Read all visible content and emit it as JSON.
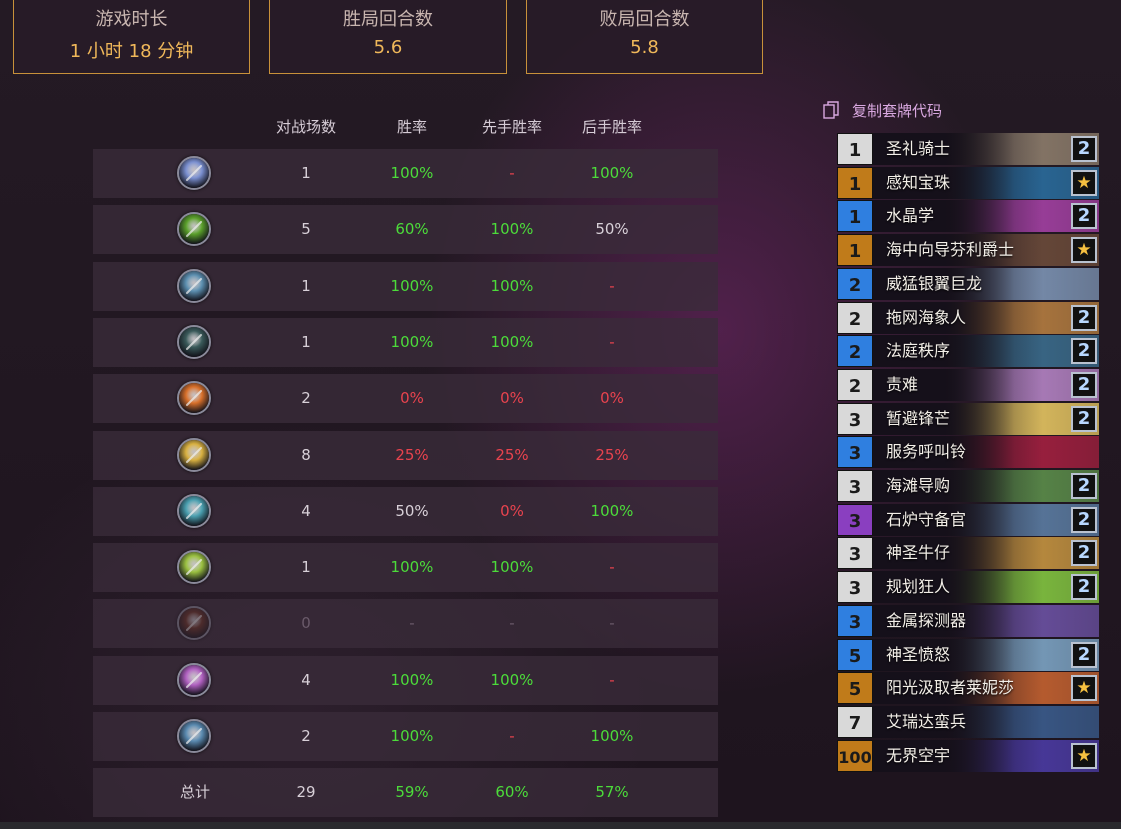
{
  "summary": [
    {
      "label": "游戏时长",
      "value": "1 小时 18 分钟"
    },
    {
      "label": "胜局回合数",
      "value": "5.6"
    },
    {
      "label": "败局回合数",
      "value": "5.8"
    }
  ],
  "table": {
    "headers": [
      "对战场数",
      "胜率",
      "先手胜率",
      "后手胜率"
    ],
    "rows": [
      {
        "icon": "priest-class-icon",
        "color": "#7a8fd0",
        "games": "1",
        "winrate": "100%",
        "first": "-",
        "second": "100%"
      },
      {
        "icon": "hunter-class-icon",
        "color": "#5aa02a",
        "games": "5",
        "winrate": "60%",
        "first": "100%",
        "second": "50%"
      },
      {
        "icon": "warrior-class-icon",
        "color": "#5c8fb0",
        "games": "1",
        "winrate": "100%",
        "first": "100%",
        "second": "-"
      },
      {
        "icon": "rogue-class-icon",
        "color": "#3a5a5a",
        "games": "1",
        "winrate": "100%",
        "first": "100%",
        "second": "-"
      },
      {
        "icon": "mage-class-icon",
        "color": "#d8702a",
        "games": "2",
        "winrate": "0%",
        "first": "0%",
        "second": "0%"
      },
      {
        "icon": "paladin-class-icon",
        "color": "#d8b040",
        "games": "8",
        "winrate": "25%",
        "first": "25%",
        "second": "25%"
      },
      {
        "icon": "shaman-class-icon",
        "color": "#4aa0b0",
        "games": "4",
        "winrate": "50%",
        "first": "0%",
        "second": "100%"
      },
      {
        "icon": "druid-class-icon",
        "color": "#9ac040",
        "games": "1",
        "winrate": "100%",
        "first": "100%",
        "second": "-"
      },
      {
        "icon": "warlock-class-icon",
        "color": "#6a3020",
        "games": "0",
        "winrate": "-",
        "first": "-",
        "second": "-"
      },
      {
        "icon": "demon-hunter-class-icon",
        "color": "#b060c0",
        "games": "4",
        "winrate": "100%",
        "first": "100%",
        "second": "-"
      },
      {
        "icon": "death-knight-class-icon",
        "color": "#5a8ab0",
        "games": "2",
        "winrate": "100%",
        "first": "-",
        "second": "100%"
      }
    ],
    "total": {
      "label": "总计",
      "games": "29",
      "winrate": "59%",
      "first": "60%",
      "second": "57%"
    }
  },
  "deck": {
    "copy_label": "复制套牌代码",
    "cards": [
      {
        "cost": "1",
        "name": "圣礼骑士",
        "count": "2",
        "rarity": "common",
        "art": "#8a7a6a"
      },
      {
        "cost": "1",
        "name": "感知宝珠",
        "count": "★",
        "rarity": "legendary",
        "art": "#2a6a9a"
      },
      {
        "cost": "1",
        "name": "水晶学",
        "count": "2",
        "rarity": "rare",
        "art": "#a040a0"
      },
      {
        "cost": "1",
        "name": "海中向导芬利爵士",
        "count": "★",
        "rarity": "legendary",
        "art": "#6a4a3a"
      },
      {
        "cost": "2",
        "name": "威猛银翼巨龙",
        "count": "",
        "rarity": "rare",
        "art": "#7a90b0"
      },
      {
        "cost": "2",
        "name": "拖网海象人",
        "count": "2",
        "rarity": "common",
        "art": "#b07a40"
      },
      {
        "cost": "2",
        "name": "法庭秩序",
        "count": "2",
        "rarity": "rare",
        "art": "#3a6a8a"
      },
      {
        "cost": "2",
        "name": "责难",
        "count": "2",
        "rarity": "common",
        "art": "#b080c0"
      },
      {
        "cost": "3",
        "name": "暂避锋芒",
        "count": "2",
        "rarity": "common",
        "art": "#e0c060"
      },
      {
        "cost": "3",
        "name": "服务呼叫铃",
        "count": "",
        "rarity": "rare",
        "art": "#a02040"
      },
      {
        "cost": "3",
        "name": "海滩导购",
        "count": "2",
        "rarity": "common",
        "art": "#5a8a4a"
      },
      {
        "cost": "3",
        "name": "石炉守备官",
        "count": "2",
        "rarity": "epic",
        "art": "#5a7aa0"
      },
      {
        "cost": "3",
        "name": "神圣牛仔",
        "count": "2",
        "rarity": "common",
        "art": "#c09040"
      },
      {
        "cost": "3",
        "name": "规划狂人",
        "count": "2",
        "rarity": "common",
        "art": "#80c040"
      },
      {
        "cost": "3",
        "name": "金属探测器",
        "count": "",
        "rarity": "rare",
        "art": "#6a50a0"
      },
      {
        "cost": "5",
        "name": "神圣愤怒",
        "count": "2",
        "rarity": "rare",
        "art": "#7aa0c0"
      },
      {
        "cost": "5",
        "name": "阳光汲取者莱妮莎",
        "count": "★",
        "rarity": "legendary",
        "art": "#c06030"
      },
      {
        "cost": "7",
        "name": "艾瑞达蛮兵",
        "count": "",
        "rarity": "common",
        "art": "#3a5a8a"
      },
      {
        "cost": "100",
        "name": "无界空宇",
        "count": "★",
        "rarity": "legendary",
        "art": "#4a3aa0"
      }
    ]
  },
  "colors": {
    "win": "#4cdc3a",
    "loss": "#e8434e",
    "neutral": "#d8d0d8",
    "muted": "#6a5a6a",
    "accent": "#f0b85a",
    "rarity": {
      "common": "#d9d9d9",
      "rare": "#2f7fe0",
      "epic": "#8a3fc0",
      "legendary": "#c07b1a"
    }
  }
}
